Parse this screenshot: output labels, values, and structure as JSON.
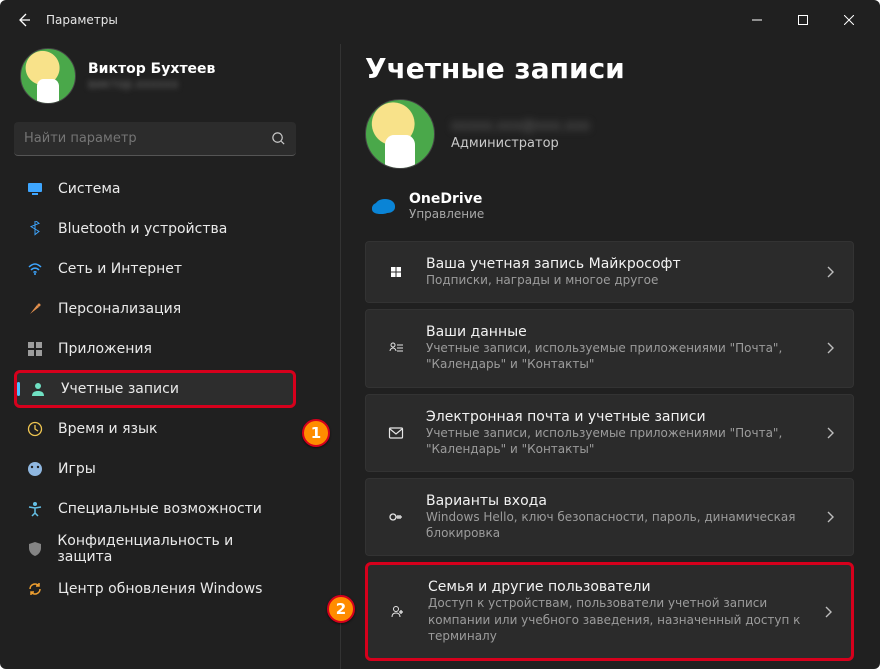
{
  "titlebar": {
    "app_title": "Параметры"
  },
  "profile": {
    "name": "Виктор Бухтеев",
    "email": "виктор.хххххх"
  },
  "search": {
    "placeholder": "Найти параметр"
  },
  "sidebar": {
    "items": [
      {
        "label": "Система",
        "icon": "monitor",
        "color": "#3ea6ff"
      },
      {
        "label": "Bluetooth и устройства",
        "icon": "bluetooth",
        "color": "#3ea6ff"
      },
      {
        "label": "Сеть и Интернет",
        "icon": "wifi",
        "color": "#3ea6ff"
      },
      {
        "label": "Персонализация",
        "icon": "brush",
        "color": "#e28f4d"
      },
      {
        "label": "Приложения",
        "icon": "apps",
        "color": "#9c9c9c"
      },
      {
        "label": "Учетные записи",
        "icon": "person",
        "color": "#6fe0c2"
      },
      {
        "label": "Время и язык",
        "icon": "clock",
        "color": "#f0c651"
      },
      {
        "label": "Игры",
        "icon": "game",
        "color": "#8fb7e0"
      },
      {
        "label": "Специальные возможности",
        "icon": "accessibility",
        "color": "#65c0e6"
      },
      {
        "label": "Конфиденциальность и защита",
        "icon": "shield",
        "color": "#848484"
      },
      {
        "label": "Центр обновления Windows",
        "icon": "update",
        "color": "#f0a030"
      }
    ],
    "active_index": 5
  },
  "main": {
    "title": "Учетные записи",
    "profile_email": "ххххх.ххх@ххх.ххх",
    "profile_role": "Администратор",
    "onedrive": {
      "title": "OneDrive",
      "sub": "Управление"
    },
    "cards": [
      {
        "title": "Ваша учетная запись Майкрософт",
        "sub": "Подписки, награды и многое другое",
        "icon": "ms"
      },
      {
        "title": "Ваши данные",
        "sub": "Учетные записи, используемые приложениями \"Почта\", \"Календарь\" и \"Контакты\"",
        "icon": "data"
      },
      {
        "title": "Электронная почта и учетные записи",
        "sub": "Учетные записи, используемые приложениями \"Почта\", \"Календарь\" и \"Контакты\"",
        "icon": "mail"
      },
      {
        "title": "Варианты входа",
        "sub": "Windows Hello, ключ безопасности, пароль, динамическая блокировка",
        "icon": "key"
      },
      {
        "title": "Семья и другие пользователи",
        "sub": "Доступ к устройствам, пользователи учетной записи компании или учебного заведения, назначенный доступ к терминалу",
        "icon": "family"
      }
    ]
  },
  "annotations": {
    "b1": "1",
    "b2": "2"
  }
}
